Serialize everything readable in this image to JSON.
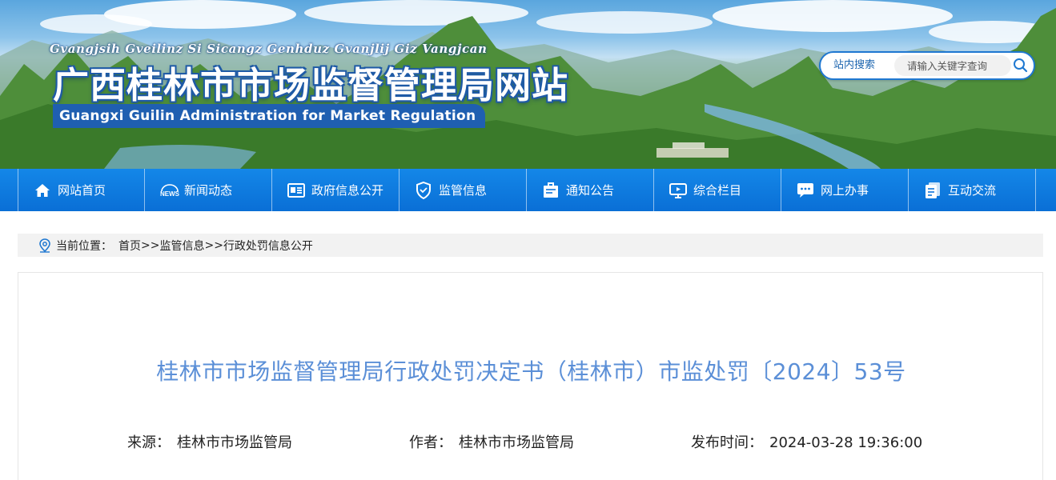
{
  "header": {
    "pinyin": "Gvangjsih Gveilinz Si Sicangz Genhduz Gvanjlij Giz Vangjcan",
    "title": "广西桂林市市场监督管理局网站",
    "english": "Guangxi Guilin Administration for Market Regulation"
  },
  "search": {
    "label": "站内搜索",
    "placeholder": "请输入关键字查询",
    "icon": "search-icon"
  },
  "nav": {
    "items": [
      {
        "label": "网站首页",
        "icon": "home-icon"
      },
      {
        "label": "新闻动态",
        "icon": "news-icon"
      },
      {
        "label": "政府信息公开",
        "icon": "info-board-icon"
      },
      {
        "label": "监管信息",
        "icon": "shield-icon"
      },
      {
        "label": "通知公告",
        "icon": "notice-icon"
      },
      {
        "label": "综合栏目",
        "icon": "monitor-icon"
      },
      {
        "label": "网上办事",
        "icon": "chat-icon"
      },
      {
        "label": "互动交流",
        "icon": "documents-icon"
      }
    ]
  },
  "breadcrumb": {
    "prefix": "当前位置：",
    "items": [
      "首页",
      "监管信息",
      "行政处罚信息公开"
    ],
    "separator": ">>"
  },
  "article": {
    "title": "桂林市市场监督管理局行政处罚决定书（桂林市）市监处罚〔2024〕53号",
    "source_label": "来源：",
    "source": "桂林市市场监管局",
    "author_label": "作者：",
    "author": "桂林市市场监管局",
    "date_label": "发布时间：",
    "date": "2024-03-28 19:36:00"
  },
  "colors": {
    "nav_blue": "#0a6fd6",
    "title_blue": "#5b8fd7",
    "banner_label_blue": "#1f5fb1"
  }
}
